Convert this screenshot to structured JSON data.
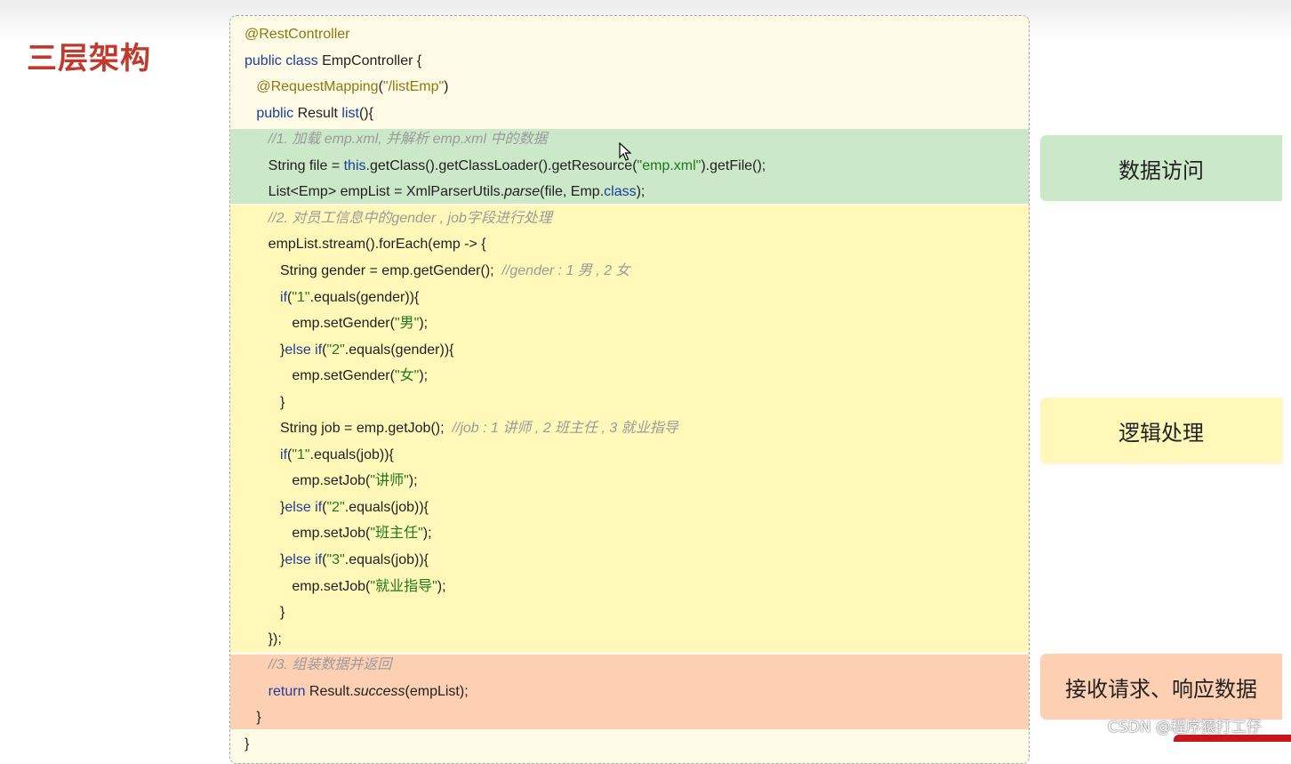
{
  "page": {
    "title": "三层架构",
    "watermark": "CSDN @程序猿打工仔"
  },
  "labels": {
    "data_access": "数据访问",
    "logic": "逻辑处理",
    "response": "接收请求、响应数据"
  },
  "code": [
    [
      {
        "t": "@RestController",
        "c": "ann"
      }
    ],
    [
      {
        "t": "public class ",
        "c": "kw"
      },
      {
        "t": "EmpController {",
        "c": ""
      }
    ],
    [
      {
        "t": "   ",
        "c": ""
      },
      {
        "t": "@RequestMapping",
        "c": "ann"
      },
      {
        "t": "(",
        "c": ""
      },
      {
        "t": "\"/listEmp\"",
        "c": "ann"
      },
      {
        "t": ")",
        "c": ""
      }
    ],
    [
      {
        "t": "   ",
        "c": ""
      },
      {
        "t": "public ",
        "c": "kw"
      },
      {
        "t": "Result ",
        "c": ""
      },
      {
        "t": "list",
        "c": "kw"
      },
      {
        "t": "(){",
        "c": ""
      }
    ],
    [
      {
        "t": "      ",
        "c": ""
      },
      {
        "t": "//1. 加载 emp.xml, 并解析 emp.xml 中的数据",
        "c": "cmt"
      }
    ],
    [
      {
        "t": "      String file = ",
        "c": ""
      },
      {
        "t": "this",
        "c": "kw"
      },
      {
        "t": ".getClass().getClassLoader().getResource(",
        "c": ""
      },
      {
        "t": "\"emp.xml\"",
        "c": "str"
      },
      {
        "t": ").getFile();",
        "c": ""
      }
    ],
    [
      {
        "t": "      List<Emp> empList = XmlParserUtils.",
        "c": ""
      },
      {
        "t": "parse",
        "c": "it"
      },
      {
        "t": "(file, Emp.",
        "c": ""
      },
      {
        "t": "class",
        "c": "kw"
      },
      {
        "t": ");",
        "c": ""
      }
    ],
    [
      {
        "t": "      ",
        "c": ""
      },
      {
        "t": "//2. 对员工信息中的gender , job字段进行处理",
        "c": "cmt"
      }
    ],
    [
      {
        "t": "      empList.stream().forEach(emp -> {",
        "c": ""
      }
    ],
    [
      {
        "t": "         String gender = emp.getGender();  ",
        "c": ""
      },
      {
        "t": "//gender : 1 男 , 2 女",
        "c": "cmt"
      }
    ],
    [
      {
        "t": "         ",
        "c": ""
      },
      {
        "t": "if",
        "c": "kw"
      },
      {
        "t": "(",
        "c": ""
      },
      {
        "t": "\"1\"",
        "c": "str"
      },
      {
        "t": ".equals(gender)){",
        "c": ""
      }
    ],
    [
      {
        "t": "            emp.setGender(",
        "c": ""
      },
      {
        "t": "\"男\"",
        "c": "str"
      },
      {
        "t": ");",
        "c": ""
      }
    ],
    [
      {
        "t": "         }",
        "c": ""
      },
      {
        "t": "else if",
        "c": "kw"
      },
      {
        "t": "(",
        "c": ""
      },
      {
        "t": "\"2\"",
        "c": "str"
      },
      {
        "t": ".equals(gender)){",
        "c": ""
      }
    ],
    [
      {
        "t": "            emp.setGender(",
        "c": ""
      },
      {
        "t": "\"女\"",
        "c": "str"
      },
      {
        "t": ");",
        "c": ""
      }
    ],
    [
      {
        "t": "         }",
        "c": ""
      }
    ],
    [
      {
        "t": "         String job = emp.getJob();  ",
        "c": ""
      },
      {
        "t": "//job : 1 讲师 , 2 班主任 , 3 就业指导",
        "c": "cmt"
      }
    ],
    [
      {
        "t": "         ",
        "c": ""
      },
      {
        "t": "if",
        "c": "kw"
      },
      {
        "t": "(",
        "c": ""
      },
      {
        "t": "\"1\"",
        "c": "str"
      },
      {
        "t": ".equals(job)){",
        "c": ""
      }
    ],
    [
      {
        "t": "            emp.setJob(",
        "c": ""
      },
      {
        "t": "\"讲师\"",
        "c": "str"
      },
      {
        "t": ");",
        "c": ""
      }
    ],
    [
      {
        "t": "         }",
        "c": ""
      },
      {
        "t": "else if",
        "c": "kw"
      },
      {
        "t": "(",
        "c": ""
      },
      {
        "t": "\"2\"",
        "c": "str"
      },
      {
        "t": ".equals(job)){",
        "c": ""
      }
    ],
    [
      {
        "t": "            emp.setJob(",
        "c": ""
      },
      {
        "t": "\"班主任\"",
        "c": "str"
      },
      {
        "t": ");",
        "c": ""
      }
    ],
    [
      {
        "t": "         }",
        "c": ""
      },
      {
        "t": "else if",
        "c": "kw"
      },
      {
        "t": "(",
        "c": ""
      },
      {
        "t": "\"3\"",
        "c": "str"
      },
      {
        "t": ".equals(job)){",
        "c": ""
      }
    ],
    [
      {
        "t": "            emp.setJob(",
        "c": ""
      },
      {
        "t": "\"就业指导\"",
        "c": "str"
      },
      {
        "t": ");",
        "c": ""
      }
    ],
    [
      {
        "t": "         }",
        "c": ""
      }
    ],
    [
      {
        "t": "      });",
        "c": ""
      }
    ],
    [
      {
        "t": "      ",
        "c": ""
      },
      {
        "t": "//3. 组装数据并返回",
        "c": "cmt"
      }
    ],
    [
      {
        "t": "      ",
        "c": ""
      },
      {
        "t": "return ",
        "c": "kw"
      },
      {
        "t": "Result.",
        "c": ""
      },
      {
        "t": "success",
        "c": "it"
      },
      {
        "t": "(empList);",
        "c": ""
      }
    ],
    [
      {
        "t": "   }",
        "c": ""
      }
    ],
    [
      {
        "t": "}",
        "c": ""
      }
    ]
  ],
  "colors": {
    "title": "#c0392b",
    "data_access_band": "#cbe8c8",
    "logic_band": "#fff8b8",
    "response_band": "#fdd0b4",
    "keyword": "#1d3d9a",
    "string": "#1b7a1b",
    "annotation": "#8a7a10",
    "comment": "#9b9b9b"
  },
  "icons": {
    "pointer": "mouse-cursor-icon"
  }
}
